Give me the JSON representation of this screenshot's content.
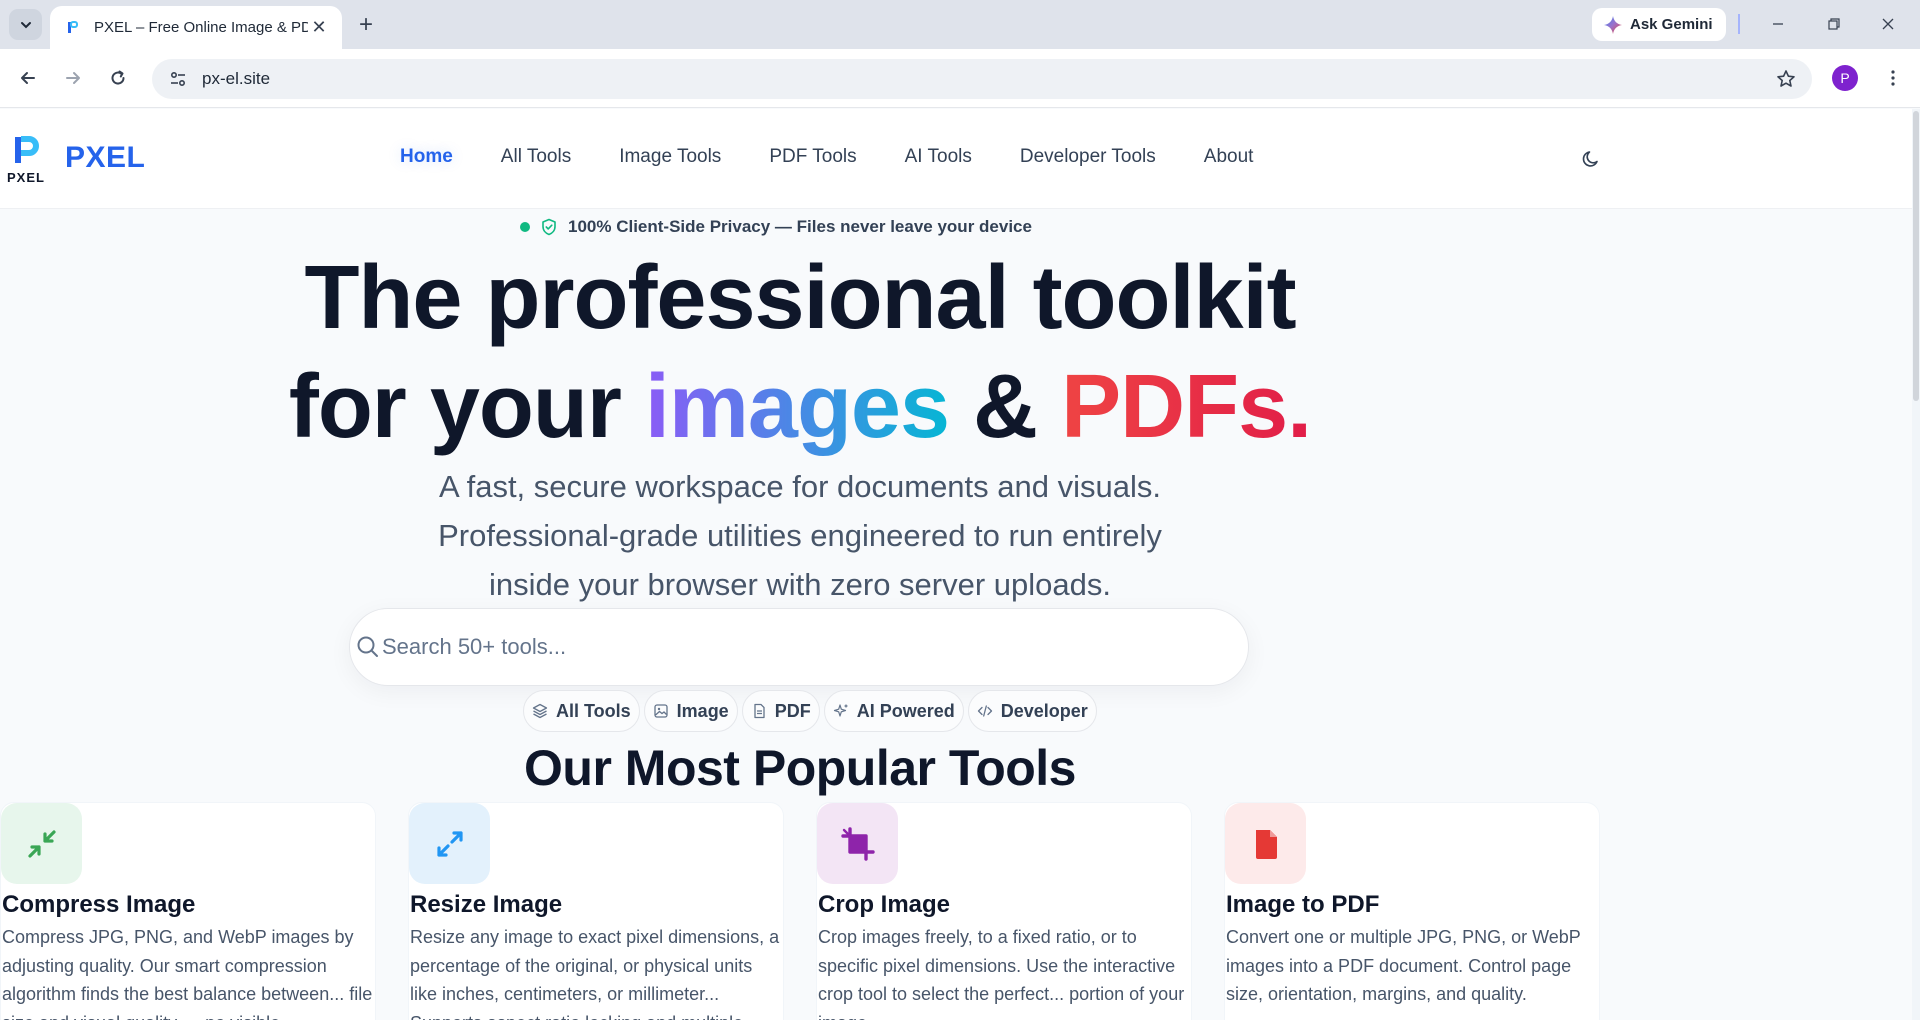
{
  "browser": {
    "tab_title": "PXEL – Free Online Image & PD",
    "ask_gemini_label": "Ask Gemini",
    "url": "px-el.site",
    "profile_initial": "P"
  },
  "site": {
    "logo_text": "PXEL",
    "brand": "PXEL",
    "nav": [
      "Home",
      "All Tools",
      "Image Tools",
      "PDF Tools",
      "AI Tools",
      "Developer Tools",
      "About"
    ]
  },
  "hero": {
    "privacy_badge": "100% Client-Side Privacy — Files never leave your device",
    "headline_line1": "The professional toolkit",
    "headline_line2_prefix": "for your ",
    "headline_images": "images",
    "headline_amp": " & ",
    "headline_pdfs": "PDFs.",
    "subtitle_lines": [
      "A fast, secure workspace for documents and visuals.",
      "Professional-grade utilities engineered to run entirely",
      "inside your browser with zero server uploads."
    ],
    "search_placeholder": "Search 50+ tools...",
    "chips": [
      "All Tools",
      "Image",
      "PDF",
      "AI Powered",
      "Developer"
    ]
  },
  "popular": {
    "title": "Our Most Popular Tools",
    "cards": [
      {
        "title": "Compress Image",
        "description": "Compress JPG, PNG, and WebP images by adjusting quality. Our smart compression algorithm finds the best balance between... file size and visual quality — no visible",
        "icon": "compress-icon",
        "icon_bg": "#e7f6ec",
        "icon_color": "#3aa655"
      },
      {
        "title": "Resize Image",
        "description": "Resize any image to exact pixel dimensions, a percentage of the original, or physical units like inches, centimeters, or millimeter... Supports aspect ratio locking and multiple",
        "icon": "resize-icon",
        "icon_bg": "#e3f1fc",
        "icon_color": "#2196f3"
      },
      {
        "title": "Crop Image",
        "description": "Crop images freely, to a fixed ratio, or to specific pixel dimensions. Use the interactive crop tool to select the perfect... portion of your image.",
        "icon": "crop-icon",
        "icon_bg": "#f3e5f5",
        "icon_color": "#8e24aa"
      },
      {
        "title": "Image to PDF",
        "description": "Convert one or multiple JPG, PNG, or WebP images into a PDF document. Control page size, orientation, margins, and quality.",
        "icon": "pdf-file-icon",
        "icon_bg": "#fdeaea",
        "icon_color": "#e53935"
      }
    ]
  },
  "colors": {
    "accent": "#2563eb",
    "images_gradient": [
      "#8b5cf6",
      "#06b6d4"
    ],
    "pdfs_gradient": [
      "#ef4444",
      "#e11d48"
    ],
    "privacy_dot": "#10b981"
  }
}
